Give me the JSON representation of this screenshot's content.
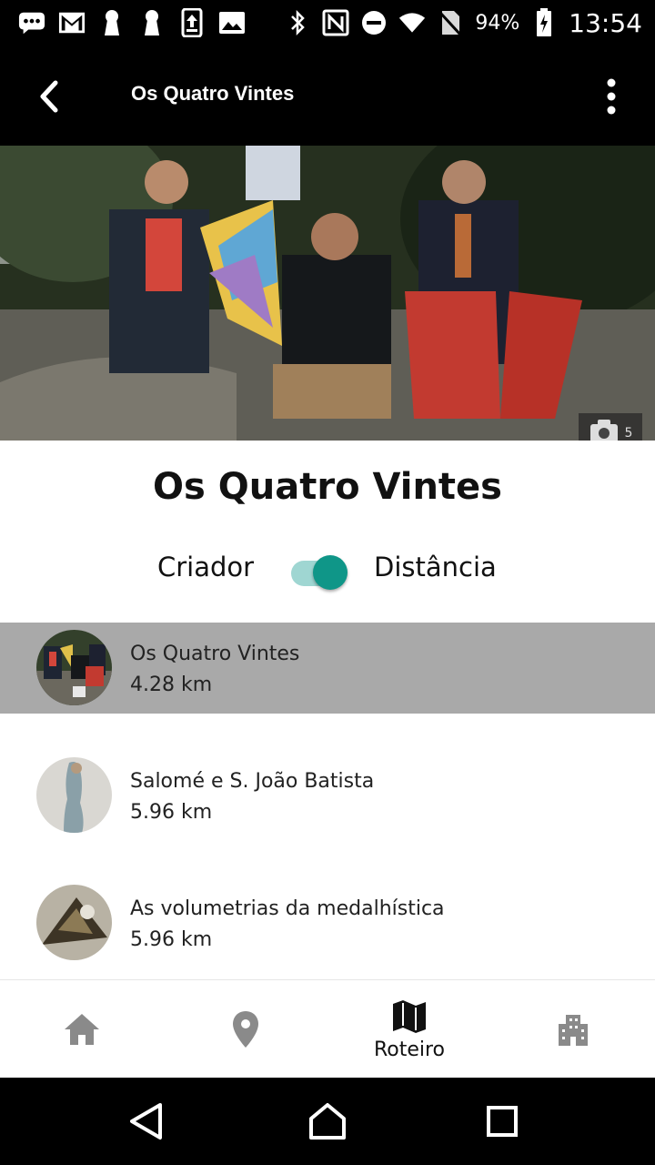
{
  "status_bar": {
    "battery": "94%",
    "time": "13:54",
    "left_icons": [
      "chat-icon",
      "gmail-icon",
      "keyhole-icon",
      "keyhole-icon",
      "upload-icon",
      "image-icon"
    ],
    "right_icons": [
      "bluetooth-icon",
      "nfc-icon",
      "dnd-icon",
      "wifi-icon",
      "no-sim-icon",
      "battery-icon"
    ]
  },
  "app_bar": {
    "title": "Os Quatro Vintes",
    "back_icon": "arrow-back-icon",
    "menu_icon": "more-vert-icon"
  },
  "hero": {
    "photo_count": "5",
    "camera_icon": "camera-icon"
  },
  "content": {
    "title": "Os Quatro Vintes",
    "toggle": {
      "left_label": "Criador",
      "right_label": "Distância",
      "state": "on",
      "accent_color": "#0f9688"
    }
  },
  "list": [
    {
      "title": "Os Quatro Vintes",
      "distance": "4.28 km",
      "selected": true
    },
    {
      "title": "Salomé e S. João Batista",
      "distance": "5.96 km",
      "selected": false
    },
    {
      "title": "As volumetrias da medalhística",
      "distance": "5.96 km",
      "selected": false
    }
  ],
  "bottom_nav": {
    "items": [
      {
        "icon": "home-icon",
        "label": ""
      },
      {
        "icon": "map-pin-icon",
        "label": ""
      },
      {
        "icon": "map-icon",
        "label": "Roteiro",
        "active": true
      },
      {
        "icon": "building-icon",
        "label": ""
      }
    ]
  },
  "system_nav": [
    "back-triangle-icon",
    "home-circle-icon",
    "recents-square-icon"
  ]
}
